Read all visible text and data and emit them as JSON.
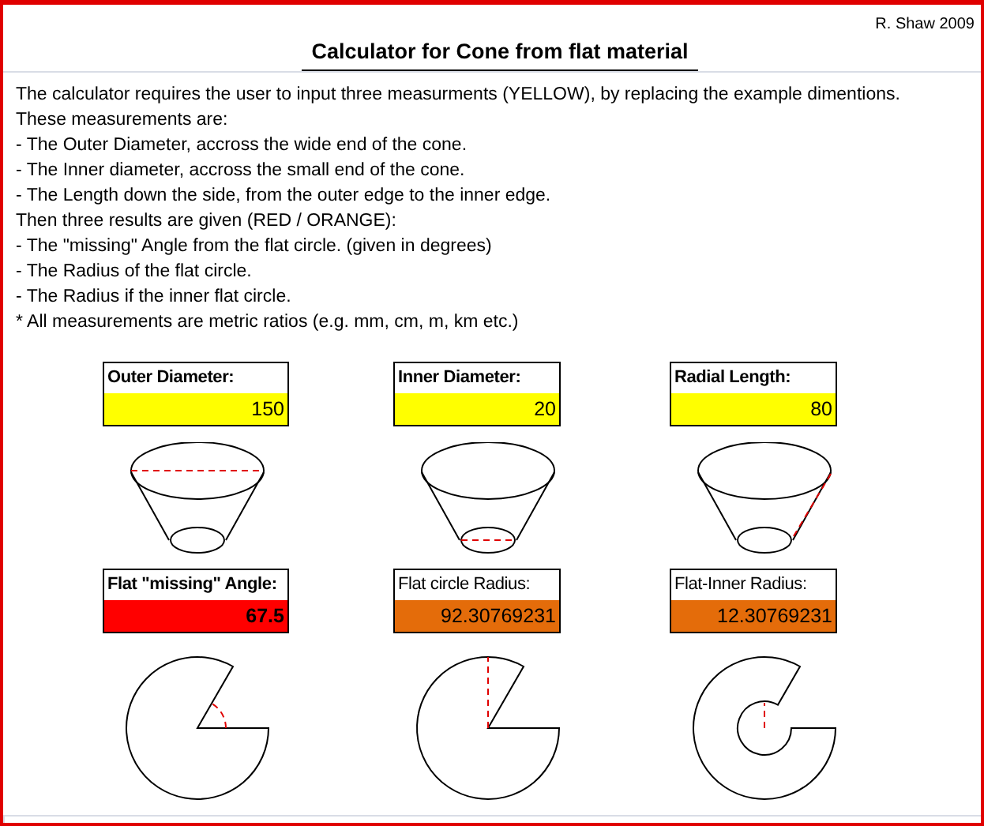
{
  "author": "R. Shaw 2009",
  "title": "Calculator for Cone from flat material",
  "description": [
    "The calculator requires the user to input three measurments (YELLOW), by replacing the example dimentions.",
    "These measurements are:",
    "- The Outer Diameter, accross the wide end of the cone.",
    "- The Inner diameter, accross the small end of the cone.",
    "- The Length down the side, from the outer edge to the inner edge.",
    "Then three results are given (RED / ORANGE):",
    "- The \"missing\" Angle from the flat circle. (given in degrees)",
    "- The Radius of the flat circle.",
    "- The Radius if the inner flat circle.",
    "* All measurements are metric ratios (e.g. mm, cm, m, km etc.)"
  ],
  "inputs": [
    {
      "label": "Outer Diameter:",
      "value": "150",
      "kind": "outer",
      "color": "#ffff00",
      "bold": true
    },
    {
      "label": "Inner Diameter:",
      "value": "20",
      "kind": "inner",
      "color": "#ffff00",
      "bold": true
    },
    {
      "label": "Radial Length:",
      "value": "80",
      "kind": "radial",
      "color": "#ffff00",
      "bold": true
    }
  ],
  "results": [
    {
      "label": "Flat \"missing\" Angle:",
      "value": "67.5",
      "kind": "angle",
      "color": "#ff0000",
      "bold": true
    },
    {
      "label": "Flat circle Radius:",
      "value": "92.30769231",
      "kind": "radius",
      "color": "#e46c0a",
      "bold": false
    },
    {
      "label": "Flat-Inner Radius:",
      "value": "12.30769231",
      "kind": "inner",
      "color": "#e46c0a",
      "bold": false
    }
  ]
}
